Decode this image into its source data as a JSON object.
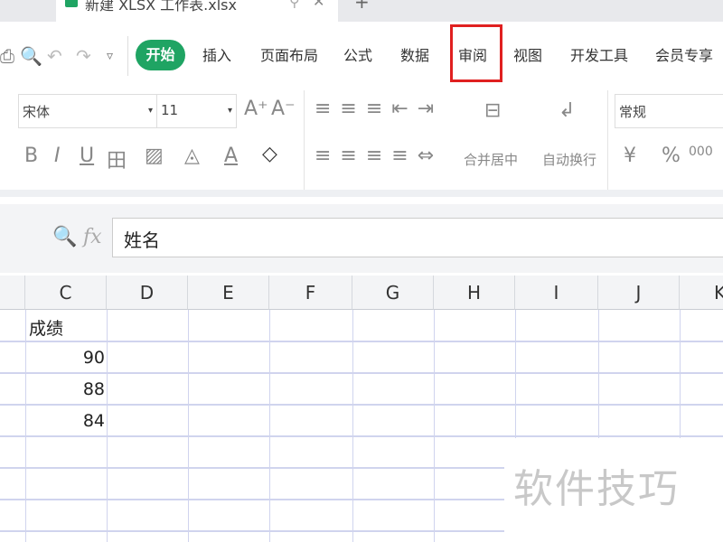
{
  "tab": {
    "title": "新建 XLSX 工作表.xlsx",
    "pin": "⚲",
    "close": "✕",
    "new": "+"
  },
  "menu": [
    "开始",
    "插入",
    "页面布局",
    "公式",
    "数据",
    "审阅",
    "视图",
    "开发工具",
    "会员专享"
  ],
  "font": {
    "name": "宋体",
    "size": "11",
    "grow": "A⁺",
    "shrink": "A⁻"
  },
  "format": {
    "bold": "B",
    "italic": "I",
    "underline": "U",
    "border": "田",
    "fill": "◇"
  },
  "align": {
    "merge": "合并居中",
    "wrap": "自动换行"
  },
  "number": {
    "format": "常规",
    "currency": "¥",
    "percent": "%",
    "thousands": "000"
  },
  "formula": {
    "fx": "fx",
    "value": "姓名"
  },
  "columns": [
    "C",
    "D",
    "E",
    "F",
    "G",
    "H",
    "I",
    "J",
    "K"
  ],
  "cells": {
    "header": "成绩",
    "values": [
      "90",
      "88",
      "84"
    ]
  },
  "watermark": "软件技巧"
}
